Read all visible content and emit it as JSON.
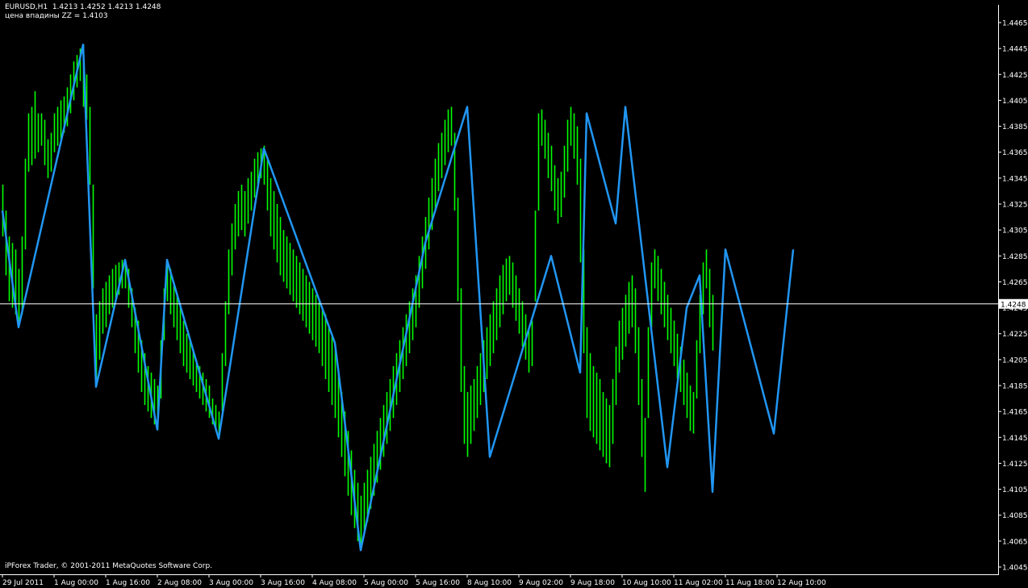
{
  "header": {
    "symbol_line": "EURUSD,H1  1.4213 1.4252 1.4213 1.4248",
    "indicator_line": "цена впадины ZZ = 1.4103"
  },
  "footer": {
    "copyright": "iPForex Trader, © 2001-2011 MetaQuotes Software Corp."
  },
  "colors": {
    "background": "#000000",
    "candles": "#00ff00",
    "zigzag": "#2196f3",
    "axis": "#ffffff",
    "price_line": "#ffffff",
    "price_label_bg": "#ffffff",
    "price_label_text": "#000000"
  },
  "chart_data": {
    "type": "line",
    "symbol": "EURUSD",
    "timeframe": "H1",
    "ylim": [
      1.4045,
      1.4465
    ],
    "y_ticks": [
      "1.4465",
      "1.4445",
      "1.4425",
      "1.4405",
      "1.4385",
      "1.4365",
      "1.4345",
      "1.4325",
      "1.4305",
      "1.4285",
      "1.4265",
      "1.4245",
      "1.4225",
      "1.4205",
      "1.4185",
      "1.4165",
      "1.4145",
      "1.4125",
      "1.4105",
      "1.4085",
      "1.4065",
      "1.4045"
    ],
    "x_ticks": [
      "29 Jul 2011",
      "1 Aug 00:00",
      "1 Aug 16:00",
      "2 Aug 08:00",
      "3 Aug 00:00",
      "3 Aug 16:00",
      "4 Aug 08:00",
      "5 Aug 00:00",
      "5 Aug 16:00",
      "8 Aug 10:00",
      "9 Aug 02:00",
      "9 Aug 18:00",
      "10 Aug 10:00",
      "11 Aug 02:00",
      "11 Aug 18:00",
      "12 Aug 10:00"
    ],
    "current_price": 1.4248,
    "current_price_label": "1.4248",
    "grid": false,
    "series": [
      {
        "kind": "zigzag",
        "points": [
          [
            0,
            1.432
          ],
          [
            5,
            1.423
          ],
          [
            25,
            1.4448
          ],
          [
            29,
            1.4184
          ],
          [
            38,
            1.4282
          ],
          [
            48,
            1.4151
          ],
          [
            51,
            1.4282
          ],
          [
            67,
            1.4144
          ],
          [
            81,
            1.4368
          ],
          [
            103,
            1.4218
          ],
          [
            111,
            1.4058
          ],
          [
            131,
            1.4295
          ],
          [
            144,
            1.44
          ],
          [
            151,
            1.413
          ],
          [
            170,
            1.4285
          ],
          [
            179,
            1.4195
          ],
          [
            181,
            1.4395
          ],
          [
            190,
            1.431
          ],
          [
            193,
            1.44
          ],
          [
            206,
            1.4122
          ],
          [
            212,
            1.4245
          ],
          [
            216,
            1.427
          ],
          [
            220,
            1.4103
          ],
          [
            224,
            1.429
          ],
          [
            239,
            1.4148
          ],
          [
            245,
            1.429
          ]
        ]
      },
      {
        "kind": "bars",
        "bars": [
          [
            1.43,
            1.434
          ],
          [
            1.427,
            1.432
          ],
          [
            1.425,
            1.43
          ],
          [
            1.4245,
            1.4295
          ],
          [
            1.424,
            1.429
          ],
          [
            1.4232,
            1.4275
          ],
          [
            1.424,
            1.43
          ],
          [
            1.429,
            1.436
          ],
          [
            1.435,
            1.4395
          ],
          [
            1.4355,
            1.44
          ],
          [
            1.436,
            1.4412
          ],
          [
            1.4365,
            1.4395
          ],
          [
            1.437,
            1.4395
          ],
          [
            1.4355,
            1.439
          ],
          [
            1.4345,
            1.4375
          ],
          [
            1.435,
            1.438
          ],
          [
            1.4365,
            1.4395
          ],
          [
            1.437,
            1.44
          ],
          [
            1.4375,
            1.4405
          ],
          [
            1.438,
            1.4408
          ],
          [
            1.4385,
            1.4415
          ],
          [
            1.4395,
            1.4425
          ],
          [
            1.4405,
            1.4435
          ],
          [
            1.4415,
            1.444
          ],
          [
            1.442,
            1.4445
          ],
          [
            1.44,
            1.4448
          ],
          [
            1.439,
            1.4425
          ],
          [
            1.434,
            1.44
          ],
          [
            1.426,
            1.434
          ],
          [
            1.4186,
            1.424
          ],
          [
            1.4205,
            1.425
          ],
          [
            1.4225,
            1.426
          ],
          [
            1.423,
            1.4265
          ],
          [
            1.424,
            1.427
          ],
          [
            1.4245,
            1.4275
          ],
          [
            1.425,
            1.4278
          ],
          [
            1.4255,
            1.428
          ],
          [
            1.426,
            1.4282
          ],
          [
            1.426,
            1.4281
          ],
          [
            1.4245,
            1.4275
          ],
          [
            1.423,
            1.426
          ],
          [
            1.421,
            1.4245
          ],
          [
            1.4195,
            1.4235
          ],
          [
            1.418,
            1.422
          ],
          [
            1.417,
            1.421
          ],
          [
            1.4165,
            1.42
          ],
          [
            1.416,
            1.4195
          ],
          [
            1.4155,
            1.419
          ],
          [
            1.4151,
            1.4185
          ],
          [
            1.4175,
            1.422
          ],
          [
            1.422,
            1.426
          ],
          [
            1.425,
            1.4282
          ],
          [
            1.424,
            1.4275
          ],
          [
            1.423,
            1.4265
          ],
          [
            1.422,
            1.4255
          ],
          [
            1.421,
            1.4245
          ],
          [
            1.42,
            1.4235
          ],
          [
            1.4195,
            1.4225
          ],
          [
            1.419,
            1.422
          ],
          [
            1.4185,
            1.4212
          ],
          [
            1.418,
            1.4205
          ],
          [
            1.4175,
            1.42
          ],
          [
            1.417,
            1.4195
          ],
          [
            1.4165,
            1.419
          ],
          [
            1.416,
            1.4185
          ],
          [
            1.4155,
            1.4175
          ],
          [
            1.415,
            1.417
          ],
          [
            1.4146,
            1.4165
          ],
          [
            1.4165,
            1.421
          ],
          [
            1.42,
            1.425
          ],
          [
            1.424,
            1.429
          ],
          [
            1.427,
            1.431
          ],
          [
            1.429,
            1.4325
          ],
          [
            1.43,
            1.4335
          ],
          [
            1.4305,
            1.434
          ],
          [
            1.43,
            1.4335
          ],
          [
            1.431,
            1.4345
          ],
          [
            1.432,
            1.435
          ],
          [
            1.433,
            1.436
          ],
          [
            1.434,
            1.4365
          ],
          [
            1.4345,
            1.4368
          ],
          [
            1.434,
            1.437
          ],
          [
            1.432,
            1.436
          ],
          [
            1.43,
            1.4345
          ],
          [
            1.429,
            1.4335
          ],
          [
            1.428,
            1.4325
          ],
          [
            1.427,
            1.4315
          ],
          [
            1.4265,
            1.4305
          ],
          [
            1.426,
            1.43
          ],
          [
            1.4255,
            1.4295
          ],
          [
            1.425,
            1.429
          ],
          [
            1.4245,
            1.4285
          ],
          [
            1.424,
            1.428
          ],
          [
            1.4235,
            1.4275
          ],
          [
            1.423,
            1.427
          ],
          [
            1.4225,
            1.4265
          ],
          [
            1.422,
            1.426
          ],
          [
            1.4215,
            1.4255
          ],
          [
            1.421,
            1.425
          ],
          [
            1.42,
            1.4245
          ],
          [
            1.419,
            1.424
          ],
          [
            1.418,
            1.423
          ],
          [
            1.417,
            1.4225
          ],
          [
            1.416,
            1.4215
          ],
          [
            1.4145,
            1.4195
          ],
          [
            1.413,
            1.418
          ],
          [
            1.4115,
            1.4165
          ],
          [
            1.41,
            1.415
          ],
          [
            1.4085,
            1.4135
          ],
          [
            1.4075,
            1.412
          ],
          [
            1.4065,
            1.411
          ],
          [
            1.4058,
            1.41
          ],
          [
            1.407,
            1.411
          ],
          [
            1.408,
            1.412
          ],
          [
            1.409,
            1.413
          ],
          [
            1.41,
            1.414
          ],
          [
            1.411,
            1.415
          ],
          [
            1.412,
            1.416
          ],
          [
            1.413,
            1.417
          ],
          [
            1.414,
            1.418
          ],
          [
            1.415,
            1.419
          ],
          [
            1.416,
            1.42
          ],
          [
            1.417,
            1.421
          ],
          [
            1.418,
            1.422
          ],
          [
            1.419,
            1.423
          ],
          [
            1.42,
            1.424
          ],
          [
            1.421,
            1.425
          ],
          [
            1.422,
            1.426
          ],
          [
            1.423,
            1.427
          ],
          [
            1.4245,
            1.4285
          ],
          [
            1.426,
            1.43
          ],
          [
            1.4275,
            1.4315
          ],
          [
            1.429,
            1.433
          ],
          [
            1.4305,
            1.4345
          ],
          [
            1.432,
            1.436
          ],
          [
            1.4335,
            1.4372
          ],
          [
            1.4345,
            1.438
          ],
          [
            1.4355,
            1.439
          ],
          [
            1.4365,
            1.4398
          ],
          [
            1.437,
            1.44
          ],
          [
            1.432,
            1.438
          ],
          [
            1.425,
            1.433
          ],
          [
            1.418,
            1.426
          ],
          [
            1.414,
            1.42
          ],
          [
            1.413,
            1.418
          ],
          [
            1.414,
            1.4185
          ],
          [
            1.415,
            1.419
          ],
          [
            1.416,
            1.42
          ],
          [
            1.417,
            1.421
          ],
          [
            1.418,
            1.422
          ],
          [
            1.419,
            1.423
          ],
          [
            1.42,
            1.424
          ],
          [
            1.421,
            1.425
          ],
          [
            1.422,
            1.426
          ],
          [
            1.423,
            1.427
          ],
          [
            1.424,
            1.4278
          ],
          [
            1.425,
            1.4283
          ],
          [
            1.4255,
            1.4285
          ],
          [
            1.4245,
            1.428
          ],
          [
            1.4235,
            1.427
          ],
          [
            1.4225,
            1.426
          ],
          [
            1.4215,
            1.425
          ],
          [
            1.4205,
            1.424
          ],
          [
            1.4195,
            1.423
          ],
          [
            1.42,
            1.4235
          ],
          [
            1.425,
            1.432
          ],
          [
            1.432,
            1.4395
          ],
          [
            1.437,
            1.4398
          ],
          [
            1.436,
            1.439
          ],
          [
            1.4345,
            1.438
          ],
          [
            1.4335,
            1.437
          ],
          [
            1.432,
            1.4355
          ],
          [
            1.431,
            1.4345
          ],
          [
            1.4315,
            1.435
          ],
          [
            1.433,
            1.437
          ],
          [
            1.435,
            1.439
          ],
          [
            1.437,
            1.44
          ],
          [
            1.436,
            1.4395
          ],
          [
            1.434,
            1.4385
          ],
          [
            1.428,
            1.436
          ],
          [
            1.421,
            1.429
          ],
          [
            1.416,
            1.423
          ],
          [
            1.415,
            1.421
          ],
          [
            1.4145,
            1.42
          ],
          [
            1.414,
            1.4195
          ],
          [
            1.4135,
            1.419
          ],
          [
            1.413,
            1.418
          ],
          [
            1.4125,
            1.4175
          ],
          [
            1.4122,
            1.417
          ],
          [
            1.414,
            1.419
          ],
          [
            1.417,
            1.4215
          ],
          [
            1.4195,
            1.4235
          ],
          [
            1.4205,
            1.4245
          ],
          [
            1.4215,
            1.4255
          ],
          [
            1.4225,
            1.4265
          ],
          [
            1.423,
            1.427
          ],
          [
            1.421,
            1.426
          ],
          [
            1.417,
            1.423
          ],
          [
            1.413,
            1.419
          ],
          [
            1.4103,
            1.416
          ],
          [
            1.416,
            1.423
          ],
          [
            1.423,
            1.428
          ],
          [
            1.426,
            1.429
          ],
          [
            1.425,
            1.4285
          ],
          [
            1.424,
            1.4275
          ],
          [
            1.423,
            1.4265
          ],
          [
            1.422,
            1.4255
          ],
          [
            1.421,
            1.4245
          ],
          [
            1.42,
            1.4235
          ],
          [
            1.419,
            1.4225
          ],
          [
            1.418,
            1.4215
          ],
          [
            1.417,
            1.4205
          ],
          [
            1.416,
            1.4195
          ],
          [
            1.415,
            1.4185
          ],
          [
            1.4148,
            1.418
          ],
          [
            1.4175,
            1.422
          ],
          [
            1.421,
            1.4255
          ],
          [
            1.424,
            1.428
          ],
          [
            1.426,
            1.429
          ],
          [
            1.423,
            1.4275
          ],
          [
            1.4212,
            1.4255
          ]
        ]
      }
    ]
  }
}
